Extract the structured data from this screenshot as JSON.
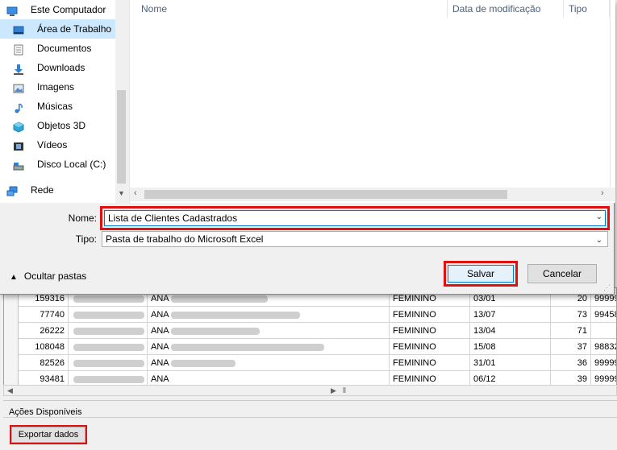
{
  "dialog": {
    "nav": {
      "items": [
        {
          "label": "Este Computador",
          "icon": "computer-icon"
        },
        {
          "label": "Área de Trabalho",
          "icon": "desktop-icon",
          "selected": true
        },
        {
          "label": "Documentos",
          "icon": "documents-icon"
        },
        {
          "label": "Downloads",
          "icon": "downloads-icon"
        },
        {
          "label": "Imagens",
          "icon": "pictures-icon"
        },
        {
          "label": "Músicas",
          "icon": "music-icon"
        },
        {
          "label": "Objetos 3D",
          "icon": "objects-3d-icon"
        },
        {
          "label": "Vídeos",
          "icon": "videos-icon"
        },
        {
          "label": "Disco Local (C:)",
          "icon": "local-disk-icon"
        },
        {
          "label": "Rede",
          "icon": "network-icon"
        }
      ]
    },
    "file_list": {
      "columns": [
        "Nome",
        "Data de modificação",
        "Tipo"
      ]
    },
    "form": {
      "name_label": "Nome:",
      "name_value": "Lista de Clientes Cadastrados",
      "type_label": "Tipo:",
      "type_value": "Pasta de trabalho do Microsoft Excel"
    },
    "hide_folders_label": "Ocultar pastas",
    "save_label": "Salvar",
    "cancel_label": "Cancelar"
  },
  "grid": {
    "rows": [
      {
        "code": "159316",
        "name": "ANA",
        "sex": "FEMININO",
        "date": "03/01",
        "age": "20",
        "tel": "99999"
      },
      {
        "code": "77740",
        "name": "ANA",
        "sex": "FEMININO",
        "date": "13/07",
        "age": "73",
        "tel": "99458"
      },
      {
        "code": "26222",
        "name": "ANA",
        "sex": "FEMININO",
        "date": "13/04",
        "age": "71",
        "tel": ""
      },
      {
        "code": "108048",
        "name": "ANA",
        "sex": "FEMININO",
        "date": "15/08",
        "age": "37",
        "tel": "98832"
      },
      {
        "code": "82526",
        "name": "ANA",
        "sex": "FEMININO",
        "date": "31/01",
        "age": "36",
        "tel": "99999"
      },
      {
        "code": "93481",
        "name": "ANA",
        "sex": "FEMININO",
        "date": "06/12",
        "age": "39",
        "tel": "99999"
      }
    ]
  },
  "actions": {
    "title": "Ações Disponíveis",
    "export_label": "Exportar dados"
  },
  "colors": {
    "highlight_red": "#e01010",
    "accent_blue": "#0078d7",
    "selection_blue": "#cce8ff"
  }
}
